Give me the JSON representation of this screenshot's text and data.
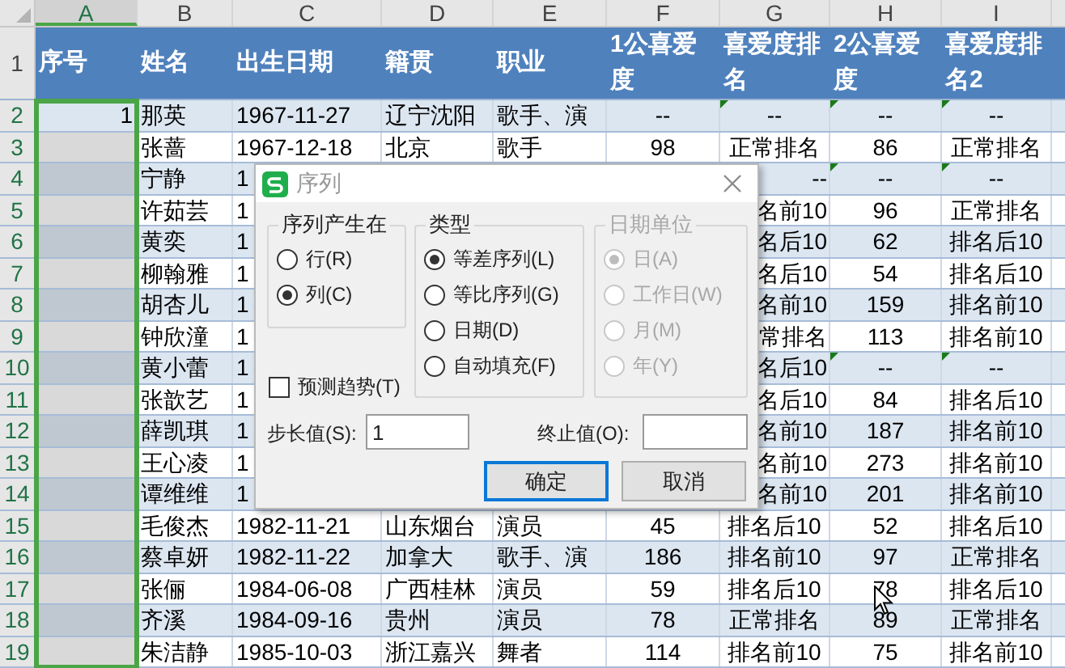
{
  "columns": [
    {
      "letter": "A",
      "selected": true
    },
    {
      "letter": "B",
      "selected": false
    },
    {
      "letter": "C",
      "selected": false
    },
    {
      "letter": "D",
      "selected": false
    },
    {
      "letter": "E",
      "selected": false
    },
    {
      "letter": "F",
      "selected": false
    },
    {
      "letter": "G",
      "selected": false
    },
    {
      "letter": "H",
      "selected": false
    },
    {
      "letter": "I",
      "selected": false
    }
  ],
  "header": {
    "row_number": "1",
    "cells": [
      "序号",
      "姓名",
      "出生日期",
      "籍贯",
      "职业",
      "1公喜爱度",
      "喜爱度排名",
      "2公喜爱度",
      "喜爱度排名2"
    ]
  },
  "rows": [
    {
      "row_number": "2",
      "selected": true,
      "flagged": true,
      "cells": [
        "1",
        "那英",
        "1967-11-27",
        "辽宁沈阳",
        "歌手、演",
        "--",
        "--",
        "--",
        "--"
      ]
    },
    {
      "row_number": "3",
      "selected": true,
      "flagged": false,
      "cells": [
        null,
        "张蔷",
        "1967-12-18",
        "北京",
        "歌手",
        "98",
        "正常排名",
        "86",
        "正常排名"
      ]
    },
    {
      "row_number": "4",
      "selected": true,
      "flagged": true,
      "cells": [
        null,
        "宁静",
        "1",
        null,
        null,
        null,
        "--",
        "--",
        "--"
      ]
    },
    {
      "row_number": "5",
      "selected": true,
      "flagged": false,
      "cells": [
        null,
        "许茹芸",
        "1",
        null,
        null,
        null,
        "名前10",
        "96",
        "正常排名"
      ]
    },
    {
      "row_number": "6",
      "selected": true,
      "flagged": false,
      "cells": [
        null,
        "黄奕",
        "1",
        null,
        null,
        null,
        "名后10",
        "62",
        "排名后10"
      ]
    },
    {
      "row_number": "7",
      "selected": true,
      "flagged": false,
      "cells": [
        null,
        "柳翰雅",
        "1",
        null,
        null,
        null,
        "名后10",
        "54",
        "排名后10"
      ]
    },
    {
      "row_number": "8",
      "selected": true,
      "flagged": false,
      "cells": [
        null,
        "胡杏儿",
        "1",
        null,
        null,
        null,
        "名前10",
        "159",
        "排名前10"
      ]
    },
    {
      "row_number": "9",
      "selected": true,
      "flagged": false,
      "cells": [
        null,
        "钟欣潼",
        "1",
        null,
        null,
        null,
        "常排名",
        "113",
        "排名前10"
      ]
    },
    {
      "row_number": "10",
      "selected": true,
      "flagged": true,
      "cells": [
        null,
        "黄小蕾",
        "1",
        null,
        null,
        null,
        "名后10",
        "--",
        "--"
      ]
    },
    {
      "row_number": "11",
      "selected": true,
      "flagged": false,
      "cells": [
        null,
        "张歆艺",
        "1",
        null,
        null,
        null,
        "名后10",
        "84",
        "排名后10"
      ]
    },
    {
      "row_number": "12",
      "selected": true,
      "flagged": false,
      "cells": [
        null,
        "薛凯琪",
        "1",
        null,
        null,
        null,
        "名前10",
        "187",
        "排名前10"
      ]
    },
    {
      "row_number": "13",
      "selected": true,
      "flagged": false,
      "cells": [
        null,
        "王心凌",
        "1",
        null,
        null,
        null,
        "名前10",
        "273",
        "排名前10"
      ]
    },
    {
      "row_number": "14",
      "selected": true,
      "flagged": false,
      "cells": [
        null,
        "谭维维",
        "1",
        null,
        null,
        null,
        "名前10",
        "201",
        "排名前10"
      ]
    },
    {
      "row_number": "15",
      "selected": true,
      "flagged": false,
      "cells": [
        null,
        "毛俊杰",
        "1982-11-21",
        "山东烟台",
        "演员",
        "45",
        "排名后10",
        "52",
        "排名后10"
      ]
    },
    {
      "row_number": "16",
      "selected": true,
      "flagged": false,
      "cells": [
        null,
        "蔡卓妍",
        "1982-11-22",
        "加拿大",
        "歌手、演",
        "186",
        "排名前10",
        "97",
        "正常排名"
      ]
    },
    {
      "row_number": "17",
      "selected": true,
      "flagged": false,
      "cells": [
        null,
        "张俪",
        "1984-06-08",
        "广西桂林",
        "演员",
        "59",
        "排名后10",
        "78",
        "排名后10"
      ]
    },
    {
      "row_number": "18",
      "selected": true,
      "flagged": false,
      "cells": [
        null,
        "齐溪",
        "1984-09-16",
        "贵州",
        "演员",
        "78",
        "正常排名",
        "89",
        "正常排名"
      ]
    },
    {
      "row_number": "19",
      "selected": true,
      "flagged": false,
      "cells": [
        null,
        "朱洁静",
        "1985-10-03",
        "浙江嘉兴",
        "舞者",
        "114",
        "排名前10",
        "75",
        "排名前10"
      ]
    }
  ],
  "dialog": {
    "title": "序列",
    "series_in": {
      "label": "序列产生在",
      "options": [
        {
          "label": "行(R)",
          "selected": false
        },
        {
          "label": "列(C)",
          "selected": true
        }
      ]
    },
    "type": {
      "label": "类型",
      "options": [
        {
          "label": "等差序列(L)",
          "selected": true
        },
        {
          "label": "等比序列(G)",
          "selected": false
        },
        {
          "label": "日期(D)",
          "selected": false
        },
        {
          "label": "自动填充(F)",
          "selected": false
        }
      ]
    },
    "date_unit": {
      "label": "日期单位",
      "disabled": true,
      "options": [
        {
          "label": "日(A)",
          "selected": true
        },
        {
          "label": "工作日(W)",
          "selected": false
        },
        {
          "label": "月(M)",
          "selected": false
        },
        {
          "label": "年(Y)",
          "selected": false
        }
      ]
    },
    "trend": {
      "label": "预测趋势(T)",
      "checked": false
    },
    "step": {
      "label": "步长值(S):",
      "value": "1"
    },
    "stop": {
      "label": "终止值(O):"
    },
    "buttons": [
      {
        "label": "确定",
        "default": true
      },
      {
        "label": "取消",
        "default": false
      }
    ]
  }
}
